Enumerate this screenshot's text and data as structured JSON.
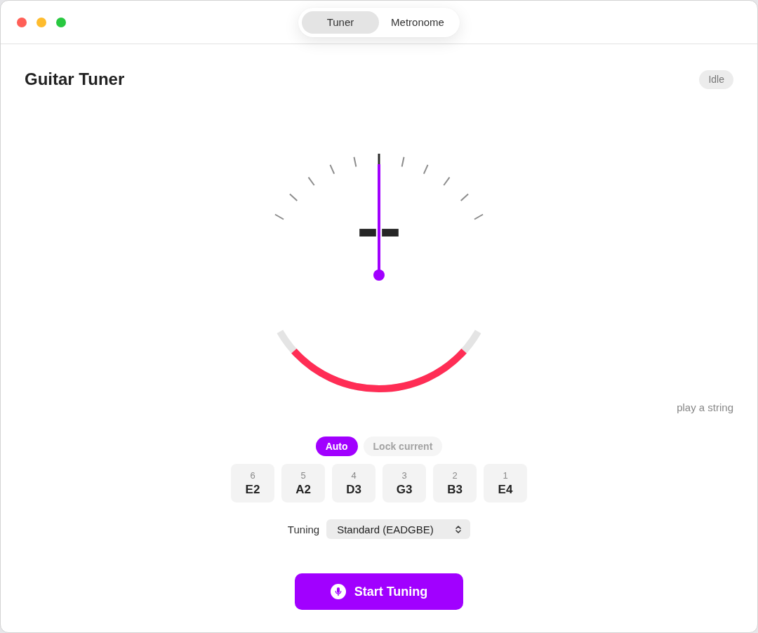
{
  "window": {
    "tabs": [
      {
        "label": "Tuner",
        "selected": true
      },
      {
        "label": "Metronome",
        "selected": false
      }
    ]
  },
  "header": {
    "title": "Guitar Tuner",
    "status": "Idle"
  },
  "gauge": {
    "note": "--",
    "needle": {
      "level": 0.5
    }
  },
  "hint": "play a string",
  "modes": [
    {
      "label": "Auto",
      "selected": true,
      "disabled": false
    },
    {
      "label": "Lock current",
      "selected": false,
      "disabled": true
    }
  ],
  "strings": [
    {
      "number": "6",
      "note": "E2",
      "selected": false
    },
    {
      "number": "5",
      "note": "A2",
      "selected": false
    },
    {
      "number": "4",
      "note": "D3",
      "selected": false
    },
    {
      "number": "3",
      "note": "G3",
      "selected": false
    },
    {
      "number": "2",
      "note": "B3",
      "selected": false
    },
    {
      "number": "1",
      "note": "E4",
      "selected": false
    }
  ],
  "tuning": {
    "label": "Tuning",
    "value": "Standard (EADGBE)"
  },
  "start_button": {
    "label": "Start Tuning"
  }
}
